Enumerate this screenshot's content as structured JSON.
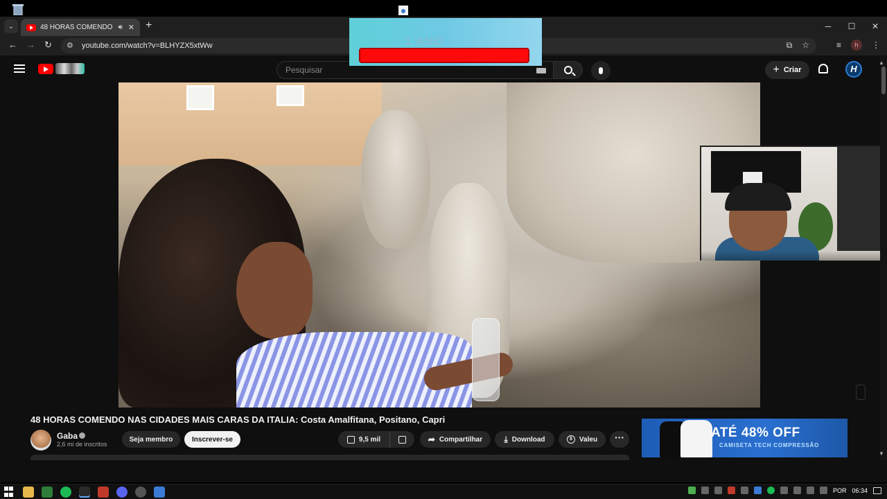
{
  "browser": {
    "tab": {
      "title": "48 HORAS COMENDO NAS CIDADES MAIS CARAS DA ITALIA: Costa Amalfitana, Positano, Capri"
    },
    "address": {
      "url": "youtube.com/watch?v=BLHYZX5xtWw"
    },
    "profile_initial": "h",
    "window_controls": [
      "─",
      "☐",
      "✕"
    ]
  },
  "overlay_banner": {
    "text": "1 ANO",
    "bar_color": "#ff0a0a"
  },
  "youtube": {
    "search": {
      "placeholder": "Pesquisar"
    },
    "create_label": "Criar",
    "avatar_initial": "H",
    "brand_color": "#ff0000"
  },
  "video": {
    "title": "48 HORAS COMENDO NAS CIDADES MAIS CARAS DA ITALIA: Costa Amalfitana, Positano, Capri",
    "channel": {
      "name": "Gaba",
      "subscribers": "2,6 mi de inscritos"
    },
    "actions": {
      "join": "Seja membro",
      "subscribe": "Inscrever-se",
      "likes": "9,5 mil",
      "share": "Compartilhar",
      "download": "Download",
      "thanks": "Valeu",
      "more": "···"
    }
  },
  "ad": {
    "headline": "ATÉ 48% OFF",
    "subline": "CAMISETA TECH COMPRESSÃO"
  },
  "taskbar": {
    "language": "POR",
    "time": "06:34"
  }
}
